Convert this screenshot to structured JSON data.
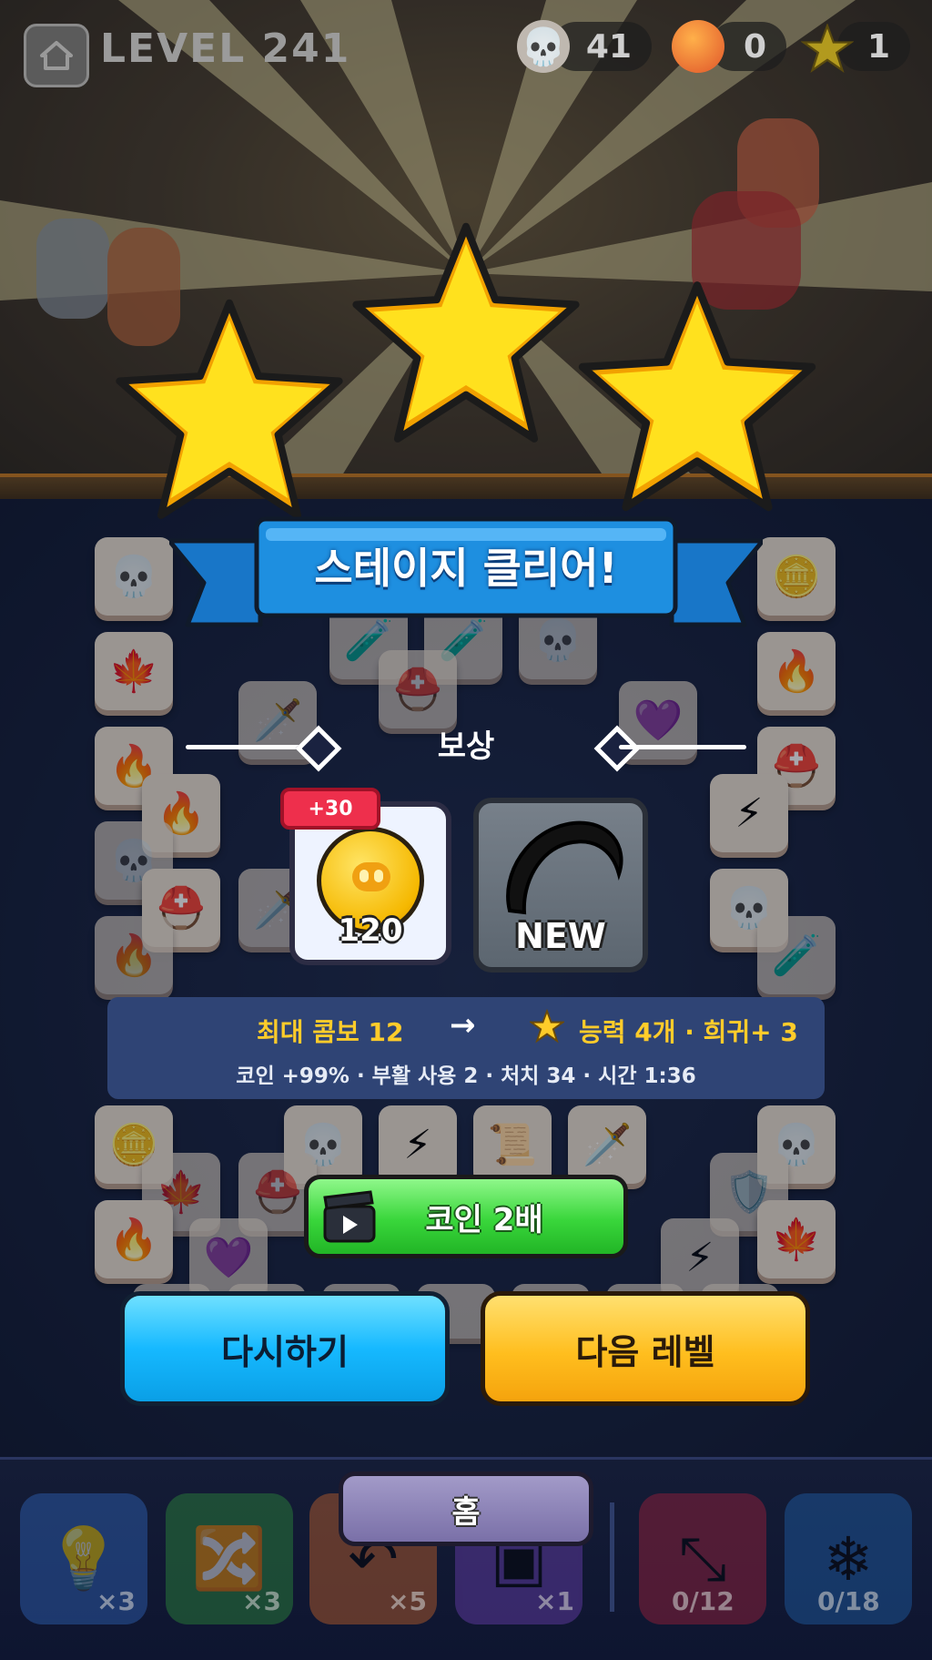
{
  "header": {
    "level_label": "LEVEL 241",
    "skull_count": "41",
    "coin_count": "0",
    "star_count": "1"
  },
  "banner": {
    "title": "스테이지 클리어!"
  },
  "reward": {
    "label": "보상",
    "bonus_badge": "+30",
    "coin_amount": "120",
    "new_item_label": "NEW"
  },
  "stats": {
    "combo": "최대 콤보 12",
    "arrow": "→",
    "ability": "능력 4개 · 희귀+ 3",
    "detail": "코인 +99%  ·  부활 사용 2  ·  처치 34  ·  시간 1:36"
  },
  "buttons": {
    "double_coins": "코인 2배",
    "retry": "다시하기",
    "next_level": "다음 레벨",
    "home": "홈"
  },
  "powerups": [
    {
      "icon": "lightbulb-icon",
      "count": "×3",
      "color": "#2f63b8"
    },
    {
      "icon": "shuffle-icon",
      "count": "×3",
      "color": "#2c8a3a"
    },
    {
      "icon": "undo-icon",
      "count": "×5",
      "color": "#c2612a"
    },
    {
      "icon": "box-icon",
      "count": "×1",
      "color": "#6a3fb0"
    },
    {
      "icon": "collapse-icon",
      "count": "0/12",
      "color": "#a0203a"
    },
    {
      "icon": "snowflake-icon",
      "count": "0/18",
      "color": "#1f5fa8"
    }
  ],
  "colors": {
    "star": "#ffd21e",
    "banner": "#1e8fe0",
    "double_button": "#39d63b",
    "retry_button": "#16b9ff",
    "next_button": "#ffbe1e",
    "home_button": "#8a80b8"
  }
}
